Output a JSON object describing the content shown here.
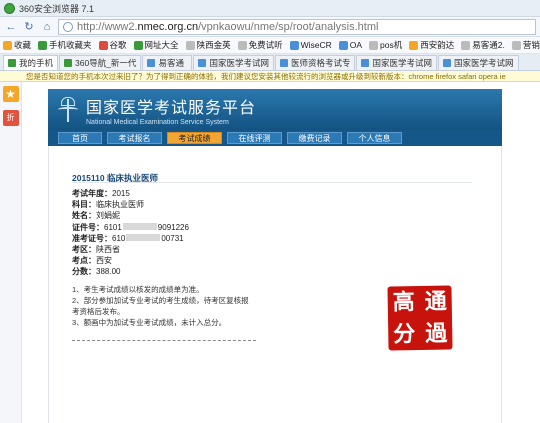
{
  "window": {
    "title": "360安全浏览器 7.1"
  },
  "address": {
    "prefix": "http://www2.",
    "domain": "nmec.org.cn",
    "path": "/vpnkaowu/nme/sp/root/analysis.html"
  },
  "bookmarks": [
    {
      "label": "收藏",
      "color": "#f5a623"
    },
    {
      "label": "手机收藏夹",
      "color": "#3a9a3a"
    },
    {
      "label": "谷歌",
      "color": "#dd4b39"
    },
    {
      "label": "网址大全",
      "color": "#3a9a3a"
    },
    {
      "label": "陕西金英",
      "color": "#999999"
    },
    {
      "label": "免费试听",
      "color": "#999999"
    },
    {
      "label": "WiseCR",
      "color": "#4a90d9"
    },
    {
      "label": "OA",
      "color": "#4a90d9"
    },
    {
      "label": "pos机",
      "color": "#999999"
    },
    {
      "label": "西安韵达",
      "color": "#f5a623"
    },
    {
      "label": "易客通2.",
      "color": "#999999"
    },
    {
      "label": "营销魔坊",
      "color": "#999999"
    }
  ],
  "tabs": [
    {
      "label": "我的手机",
      "active": true
    },
    {
      "label": "360导航_新一代"
    },
    {
      "label": "易客通"
    },
    {
      "label": "国家医学考试网"
    },
    {
      "label": "医师资格考试专"
    },
    {
      "label": "国家医学考试网"
    },
    {
      "label": "国家医学考试网"
    }
  ],
  "infobar": "您是否知道您的手机本次过来旧了？为了得到正确的体验，我们建议您安装其他较流行的浏览器或升级到较新版本：chrome firefox safari opera ie",
  "site": {
    "title_cn": "国家医学考试服务平台",
    "title_en": "National Medical Examination Service System",
    "menu": [
      {
        "label": "首页"
      },
      {
        "label": "考试报名"
      },
      {
        "label": "考试成绩",
        "current": true
      },
      {
        "label": "在线评测"
      },
      {
        "label": "缴费记录"
      },
      {
        "label": "个人信息"
      }
    ]
  },
  "result": {
    "heading": "2015110  临床执业医师",
    "fields": [
      {
        "label": "考试年度：",
        "value": "2015"
      },
      {
        "label": "科目：",
        "value": "临床执业医师"
      },
      {
        "label": "姓名：",
        "value": "刘娟妮"
      },
      {
        "label": "证件号：",
        "value": "6101",
        "value2": "9091226"
      },
      {
        "label": "准考证号：",
        "value": "610",
        "value2": "00731"
      },
      {
        "label": "考区：",
        "value": "陕西省"
      },
      {
        "label": "考点：",
        "value": "西安"
      },
      {
        "label": "分数：",
        "value": "388.00"
      }
    ],
    "notes": [
      "1、考生考试成绩以核发的成绩单为准。",
      "2、部分参加加试专业考试的考生成绩，待考区复核报",
      "考资格后发布。",
      "3、额画中为加试专业考试成绩，未计入总分。"
    ]
  },
  "stamp": [
    "高",
    "通",
    "分",
    "過"
  ]
}
